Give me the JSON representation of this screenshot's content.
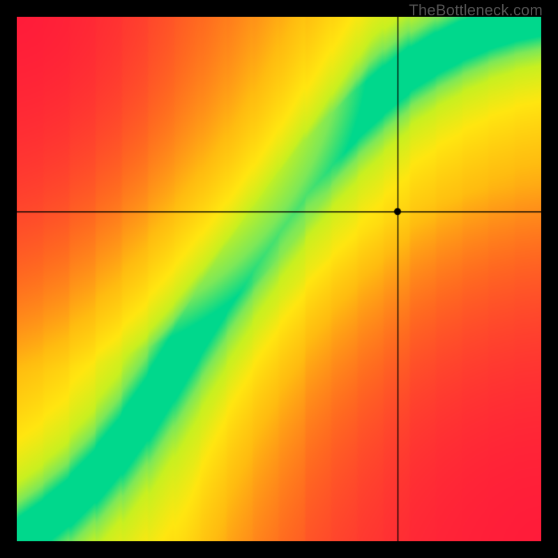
{
  "watermark": "TheBottleneck.com",
  "chart_data": {
    "type": "heatmap",
    "title": "",
    "xlabel": "",
    "ylabel": "",
    "xlim": [
      0,
      1
    ],
    "ylim": [
      0,
      1
    ],
    "marker": {
      "x": 0.727,
      "y": 0.628
    },
    "guide_lines": {
      "vertical_x": 0.727,
      "horizontal_y": 0.628
    },
    "ideal_curve_points": [
      {
        "x": 0.0,
        "y": 0.0
      },
      {
        "x": 0.05,
        "y": 0.035
      },
      {
        "x": 0.1,
        "y": 0.075
      },
      {
        "x": 0.15,
        "y": 0.125
      },
      {
        "x": 0.2,
        "y": 0.185
      },
      {
        "x": 0.25,
        "y": 0.255
      },
      {
        "x": 0.3,
        "y": 0.335
      },
      {
        "x": 0.35,
        "y": 0.42
      },
      {
        "x": 0.4,
        "y": 0.5
      },
      {
        "x": 0.45,
        "y": 0.575
      },
      {
        "x": 0.5,
        "y": 0.645
      },
      {
        "x": 0.55,
        "y": 0.71
      },
      {
        "x": 0.6,
        "y": 0.765
      },
      {
        "x": 0.65,
        "y": 0.815
      },
      {
        "x": 0.7,
        "y": 0.86
      },
      {
        "x": 0.75,
        "y": 0.9
      },
      {
        "x": 0.8,
        "y": 0.93
      },
      {
        "x": 0.85,
        "y": 0.955
      },
      {
        "x": 0.9,
        "y": 0.975
      },
      {
        "x": 0.95,
        "y": 0.99
      },
      {
        "x": 1.0,
        "y": 1.0
      }
    ],
    "colormap_stops": [
      {
        "t": 0.0,
        "color": "#ff1a3a"
      },
      {
        "t": 0.25,
        "color": "#ff6a20"
      },
      {
        "t": 0.5,
        "color": "#ffbc10"
      },
      {
        "t": 0.7,
        "color": "#ffe610"
      },
      {
        "t": 0.85,
        "color": "#c8f020"
      },
      {
        "t": 0.93,
        "color": "#7de858"
      },
      {
        "t": 1.0,
        "color": "#00d88c"
      }
    ],
    "band_half_width": 0.035,
    "falloff_scale": 0.55
  }
}
